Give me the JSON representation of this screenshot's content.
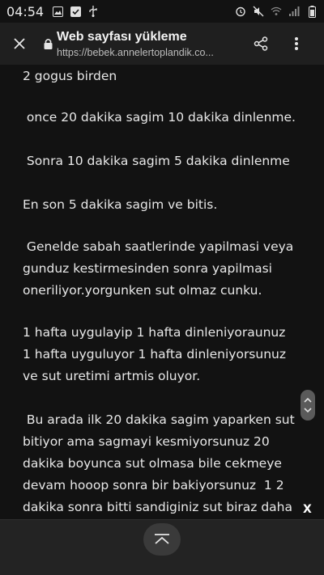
{
  "status_bar": {
    "time": "04:54",
    "left_icons": [
      "gallery-icon",
      "check-icon",
      "usb-icon"
    ],
    "right_icons": [
      "alarm-icon",
      "mute-icon",
      "wifi-icon",
      "signal-icon",
      "battery-icon"
    ]
  },
  "app_bar": {
    "title": "Web sayfası yükleme",
    "url": "https://bebek.annelertoplandik.co..."
  },
  "content": {
    "paragraphs": [
      "2 gogus birden",
      " once 20 dakika sagim 10 dakika dinlenme.",
      " Sonra 10 dakika sagim 5 dakika dinlenme",
      "En son 5 dakika sagim ve bitis.",
      " Genelde sabah saatlerinde yapilmasi veya\ngunduz kestirmesinden sonra yapilmasi\noneriliyor.yorgunken sut olmaz cunku.",
      "1 hafta uygulayip 1 hafta dinleniyoraunuz\n1 hafta uyguluyor 1 hafta dinleniyorsunuz\nve sut uretimi artmis oluyor.",
      " Bu arada ilk 20 dakika sagim yaparken sut\nbitiyor ama sagmayi kesmiyorsunuz 20\ndakika boyunca sut olmasa bile cekmeye\ndevam hooop sonra bir bakiyorsunuz  1 2\ndakika sonra bitti sandiginiz sut biraz daha"
    ]
  },
  "overlay": {
    "ad_close_label": "X"
  }
}
